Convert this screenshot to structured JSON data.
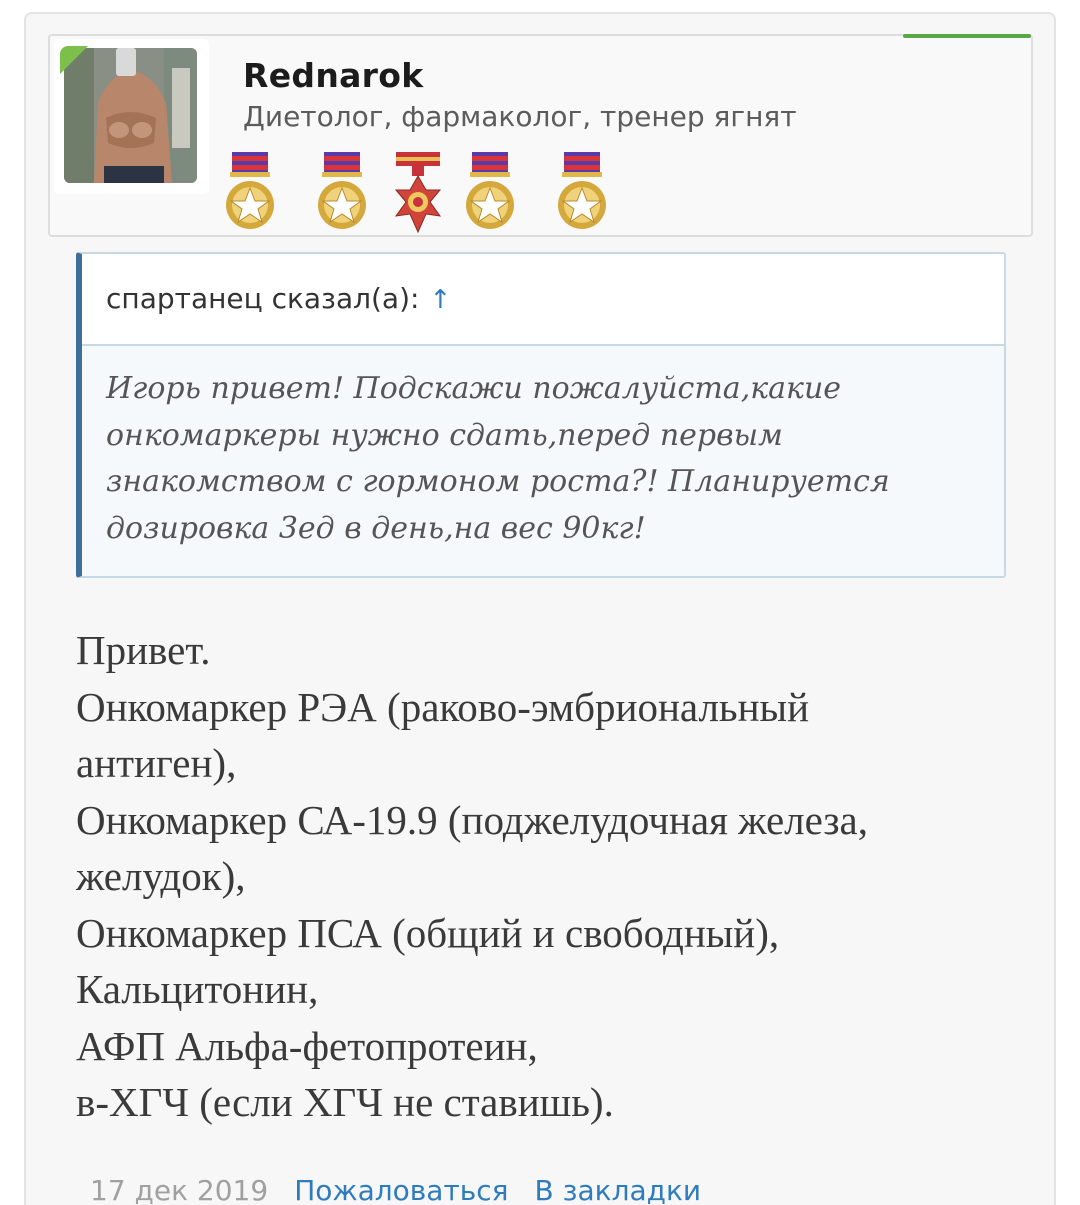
{
  "user": {
    "name": "Rednarok",
    "title": "Диетолог, фармаколог, тренер ягнят",
    "avatar_icon": "user-photo-avatar",
    "online_color": "#7cc04b",
    "medals": [
      {
        "icon": "gold-star-medal-icon"
      },
      {
        "icon": "gold-star-medal-icon"
      },
      {
        "icon": "order-cross-medal-icon"
      },
      {
        "icon": "gold-star-medal-icon"
      },
      {
        "icon": "gold-star-medal-icon"
      }
    ]
  },
  "quote": {
    "author_label": "спартанец сказал(а):",
    "jump_icon": "↑",
    "lines": [
      "Игорь привет! Подскажи пожалуйста,какие",
      "онкомаркеры нужно сдать,перед первым",
      "знакомством с гормоном роста?! Планируется",
      "дозировка 3ед в день,на вес 90кг!"
    ]
  },
  "message": {
    "lines": [
      "Привет.",
      "Онкомаркер РЭА (раково-эмбриональный",
      "антиген),",
      "Онкомаркер СА-19.9 (поджелудочная железа,",
      "желудок),",
      "Онкомаркер ПСА (общий и свободный),",
      "Кальцитонин,",
      "АФП Альфа-фетопротеин,",
      "в-ХГЧ (если ХГЧ не ставишь)."
    ]
  },
  "footer": {
    "date": "17 дек 2019",
    "report_label": "Пожаловаться",
    "bookmark_label": "В закладки"
  },
  "colors": {
    "link": "#2e7cbf",
    "quote_border": "#3f6f99",
    "accent_green": "#5aa844"
  }
}
